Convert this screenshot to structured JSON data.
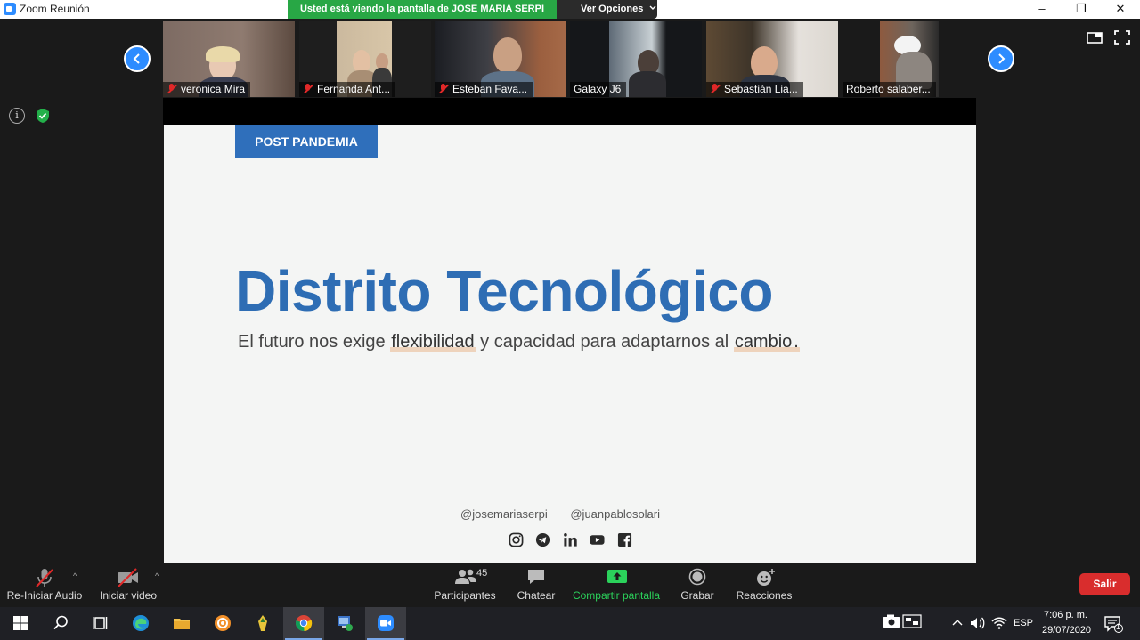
{
  "window": {
    "title": "Zoom Reunión",
    "share_banner": "Usted está viendo la pantalla de JOSE MARIA SERPI",
    "view_options": "Ver Opciones",
    "min_glyph": "–",
    "max_glyph": "❐",
    "close_glyph": "✕"
  },
  "participants_strip": [
    {
      "name": "veronica Mira",
      "muted": true
    },
    {
      "name": "Fernanda Ant...",
      "muted": true
    },
    {
      "name": "Esteban Fava...",
      "muted": true
    },
    {
      "name": "Galaxy J6",
      "muted": false
    },
    {
      "name": "Sebastián Lia...",
      "muted": true
    },
    {
      "name": "Roberto salaber...",
      "muted": false
    }
  ],
  "slide": {
    "tag": "POST PANDEMIA",
    "title": "Distrito Tecnológico",
    "subtitle_part1": "El futuro nos exige ",
    "subtitle_hl1": "flexibilidad",
    "subtitle_part2": " y capacidad para adaptarnos al ",
    "subtitle_hl2": "cambio",
    "subtitle_part3": ".",
    "handles": [
      "@josemariaserpi",
      "@juanpablosolari"
    ],
    "social_icons": [
      "instagram-icon",
      "telegram-icon",
      "linkedin-icon",
      "youtube-icon",
      "facebook-icon"
    ]
  },
  "toolbar": {
    "audio_label": "Re-Iniciar Audio",
    "video_label": "Iniciar video",
    "participants_label": "Participantes",
    "participants_count": "45",
    "chat_label": "Chatear",
    "share_label": "Compartir pantalla",
    "record_label": "Grabar",
    "reactions_label": "Reacciones",
    "exit_label": "Salir",
    "share_color": "#2bd25b"
  },
  "taskbar": {
    "apps": [
      "windows-start-icon",
      "search-icon",
      "task-view-icon",
      "edge-icon",
      "file-explorer-icon",
      "settings-icon",
      "app-icon",
      "chrome-icon",
      "network-app-icon",
      "zoom-icon"
    ],
    "language": "ESP",
    "time": "7:06 p. m.",
    "date": "29/07/2020",
    "notification_count": "1"
  }
}
